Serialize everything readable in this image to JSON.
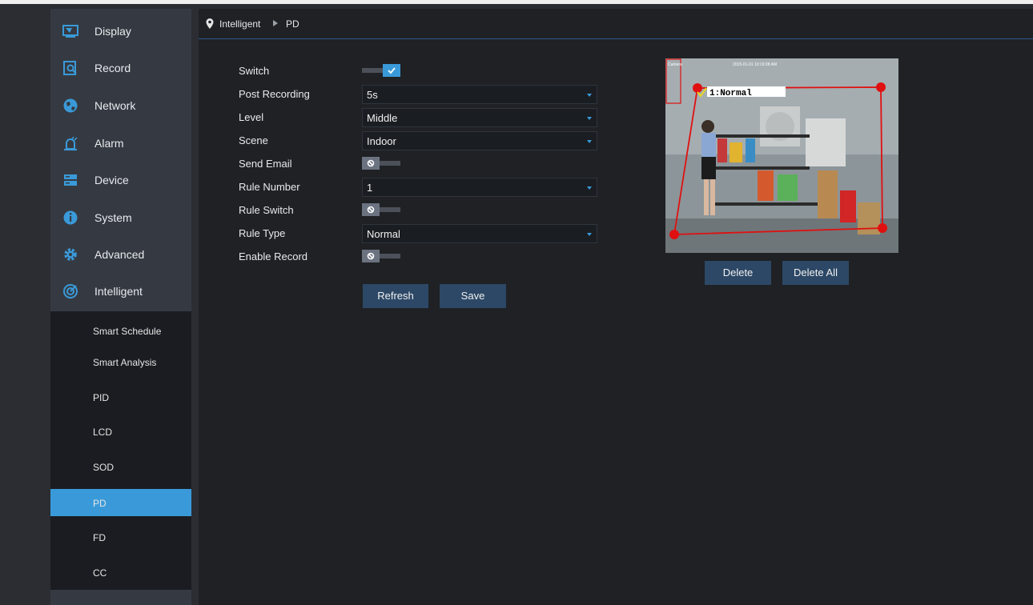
{
  "sidebar": {
    "items": [
      {
        "label": "Display",
        "icon": "monitor-icon"
      },
      {
        "label": "Record",
        "icon": "record-search-icon"
      },
      {
        "label": "Network",
        "icon": "globe-icon"
      },
      {
        "label": "Alarm",
        "icon": "alarm-siren-icon"
      },
      {
        "label": "Device",
        "icon": "hard-drive-icon"
      },
      {
        "label": "System",
        "icon": "info-icon"
      },
      {
        "label": "Advanced",
        "icon": "gear-icon"
      },
      {
        "label": "Intelligent",
        "icon": "intelligent-icon"
      }
    ],
    "submenu": [
      {
        "label": "Smart Schedule"
      },
      {
        "label": "Smart Analysis"
      },
      {
        "label": "PID"
      },
      {
        "label": "LCD"
      },
      {
        "label": "SOD"
      },
      {
        "label": "PD",
        "active": true
      },
      {
        "label": "FD"
      },
      {
        "label": "CC"
      }
    ]
  },
  "breadcrumb": {
    "section": "Intelligent",
    "page": "PD"
  },
  "form": {
    "switch": {
      "label": "Switch",
      "on": true
    },
    "post_recording": {
      "label": "Post Recording",
      "value": "5s"
    },
    "level": {
      "label": "Level",
      "value": "Middle"
    },
    "scene": {
      "label": "Scene",
      "value": "Indoor"
    },
    "send_email": {
      "label": "Send Email",
      "on": false
    },
    "rule_number": {
      "label": "Rule Number",
      "value": "1"
    },
    "rule_switch": {
      "label": "Rule Switch",
      "on": false
    },
    "rule_type": {
      "label": "Rule Type",
      "value": "Normal"
    },
    "enable_record": {
      "label": "Enable Record",
      "on": false
    }
  },
  "buttons": {
    "refresh": "Refresh",
    "save": "Save",
    "delete": "Delete",
    "delete_all": "Delete All"
  },
  "preview": {
    "camera_label": "Camera",
    "timestamp": "2015-01-01 10:19:28 AM",
    "rule_label": "1:Normal"
  },
  "colors": {
    "accent": "#3a9ad9",
    "rule_line": "#e01010",
    "button": "#2c4866"
  }
}
